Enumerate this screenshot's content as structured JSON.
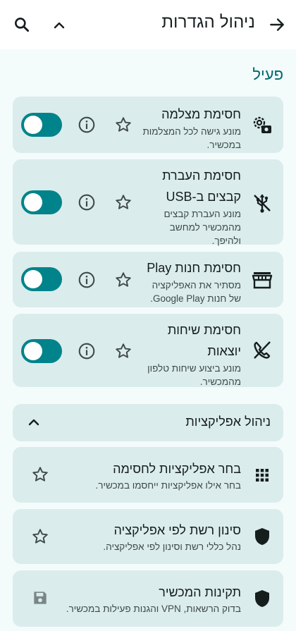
{
  "header": {
    "title": "ניהול הגדרות"
  },
  "section": {
    "active_label": "פעיל"
  },
  "policies": [
    {
      "title": "חסימת מצלמה",
      "description": "מונע גישה לכל המצלמות במכשיר."
    },
    {
      "title": "חסימת העברת קבצים ב-USB",
      "description": "מונע העברת קבצים מהמכשיר למחשב ולהיפך."
    },
    {
      "title": "חסימת חנות Play",
      "description": "מסתיר את האפליקציה של חנות Google Play."
    },
    {
      "title": "חסימת שיחות יוצאות",
      "description": "מונע ביצוע שיחות טלפון מהמכשיר."
    }
  ],
  "app_management": {
    "label": "ניהול אפליקציות"
  },
  "items": [
    {
      "title": "בחר אפליקציות לחסימה",
      "description": "בחר אילו אפליקציות ייחסמו במכשיר."
    },
    {
      "title": "סינון רשת לפי אפליקציה",
      "description": "נהל כללי רשת וסינון לפי אפליקציה."
    },
    {
      "title": "תקינות המכשיר",
      "description": "בדוק הרשאות, VPN והגנות פעילות במכשיר."
    }
  ],
  "colors": {
    "accent": "#00838a",
    "card_bg": "#daecec",
    "page_bg": "#f4fbfb"
  }
}
